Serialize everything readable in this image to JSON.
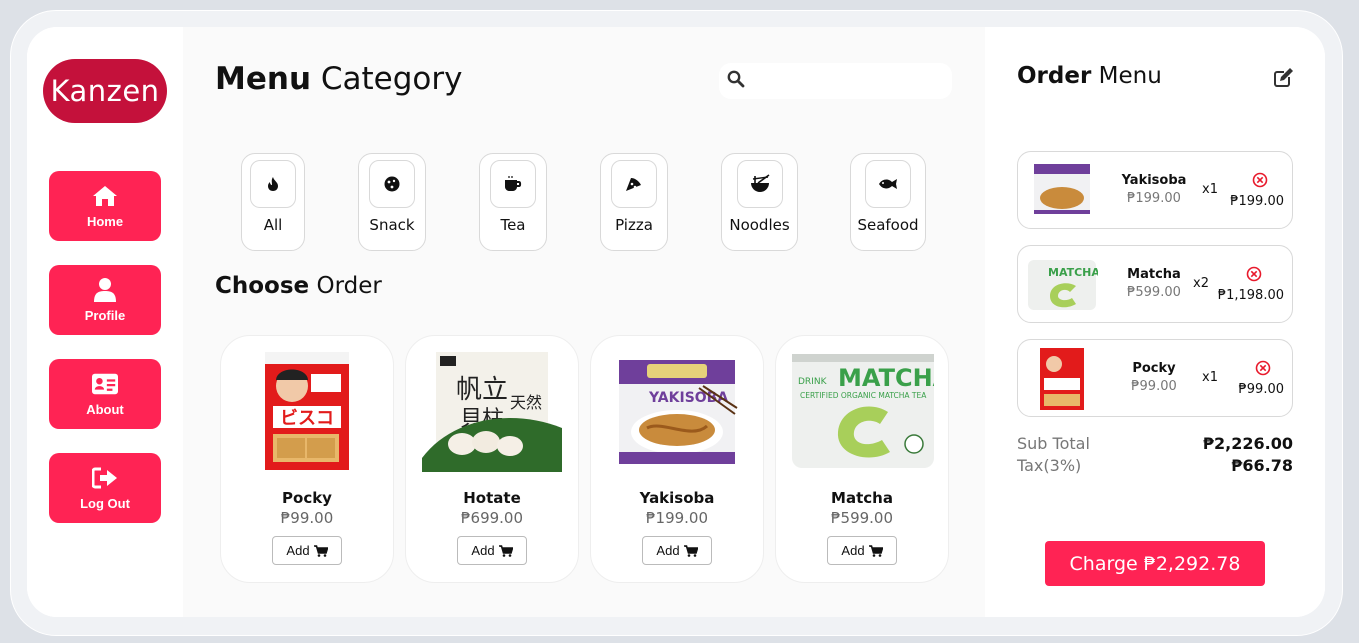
{
  "brand": {
    "logo_text": "Kanzen",
    "accent": "#ff2354",
    "logo_bg": "#c4113b"
  },
  "sidebar": {
    "items": [
      {
        "label": "Home",
        "icon": "home-icon"
      },
      {
        "label": "Profile",
        "icon": "user-icon"
      },
      {
        "label": "About",
        "icon": "id-card-icon"
      },
      {
        "label": "Log Out",
        "icon": "sign-out-icon"
      }
    ]
  },
  "main": {
    "title_bold": "Menu",
    "title_rest": "Category",
    "search": {
      "placeholder": "",
      "value": ""
    },
    "categories": [
      {
        "label": "All",
        "icon": "fire-icon"
      },
      {
        "label": "Snack",
        "icon": "cookie-icon"
      },
      {
        "label": "Tea",
        "icon": "mug-icon"
      },
      {
        "label": "Pizza",
        "icon": "pizza-slice-icon"
      },
      {
        "label": "Noodles",
        "icon": "noodle-bowl-icon"
      },
      {
        "label": "Seafood",
        "icon": "fish-icon"
      }
    ],
    "section_bold": "Choose",
    "section_rest": "Order",
    "products": [
      {
        "name": "Pocky",
        "price": "₱99.00",
        "add_label": "Add"
      },
      {
        "name": "Hotate",
        "price": "₱699.00",
        "add_label": "Add"
      },
      {
        "name": "Yakisoba",
        "price": "₱199.00",
        "add_label": "Add"
      },
      {
        "name": "Matcha",
        "price": "₱599.00",
        "add_label": "Add"
      }
    ]
  },
  "order": {
    "title_bold": "Order",
    "title_rest": "Menu",
    "items": [
      {
        "name": "Yakisoba",
        "price": "₱199.00",
        "qty": "x1",
        "total": "₱199.00"
      },
      {
        "name": "Matcha",
        "price": "₱599.00",
        "qty": "x2",
        "total": "₱1,198.00"
      },
      {
        "name": "Pocky",
        "price": "₱99.00",
        "qty": "x1",
        "total": "₱99.00"
      }
    ],
    "subtotal_label": "Sub Total",
    "subtotal_value": "₱2,226.00",
    "tax_label": "Tax(3%)",
    "tax_value": "₱66.78",
    "charge_label": "Charge ₱2,292.78"
  }
}
